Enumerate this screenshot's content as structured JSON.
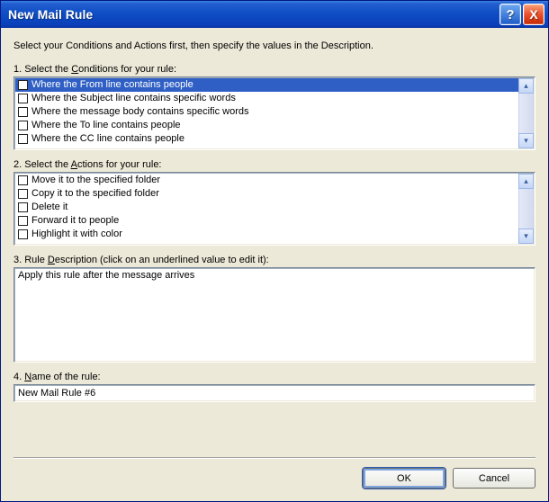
{
  "window": {
    "title": "New Mail Rule",
    "help_icon": "?",
    "close_icon": "X"
  },
  "intro": "Select your Conditions and Actions first, then specify the values in the Description.",
  "section1": {
    "label_pre": "1. Select the ",
    "label_u": "C",
    "label_post": "onditions for your rule:"
  },
  "section2": {
    "label_pre": "2. Select the ",
    "label_u": "A",
    "label_post": "ctions for your rule:"
  },
  "section3": {
    "label_pre": "3. Rule ",
    "label_u": "D",
    "label_post": "escription (click on an underlined value to edit it):"
  },
  "section4": {
    "label_pre": "4. ",
    "label_u": "N",
    "label_post": "ame of the rule:"
  },
  "conditions": {
    "items": [
      {
        "label": "Where the From line contains people",
        "selected": true
      },
      {
        "label": "Where the Subject line contains specific words",
        "selected": false
      },
      {
        "label": "Where the message body contains specific words",
        "selected": false
      },
      {
        "label": "Where the To line contains people",
        "selected": false
      },
      {
        "label": "Where the CC line contains people",
        "selected": false
      }
    ]
  },
  "actions": {
    "items": [
      {
        "label": "Move it to the specified folder",
        "selected": false
      },
      {
        "label": "Copy it to the specified folder",
        "selected": false
      },
      {
        "label": "Delete it",
        "selected": false
      },
      {
        "label": "Forward it to people",
        "selected": false
      },
      {
        "label": "Highlight it with color",
        "selected": false
      }
    ]
  },
  "description_text": "Apply this rule after the message arrives",
  "rule_name": "New Mail Rule #6",
  "scroll": {
    "up": "▴",
    "down": "▾"
  },
  "buttons": {
    "ok": "OK",
    "cancel": "Cancel"
  }
}
